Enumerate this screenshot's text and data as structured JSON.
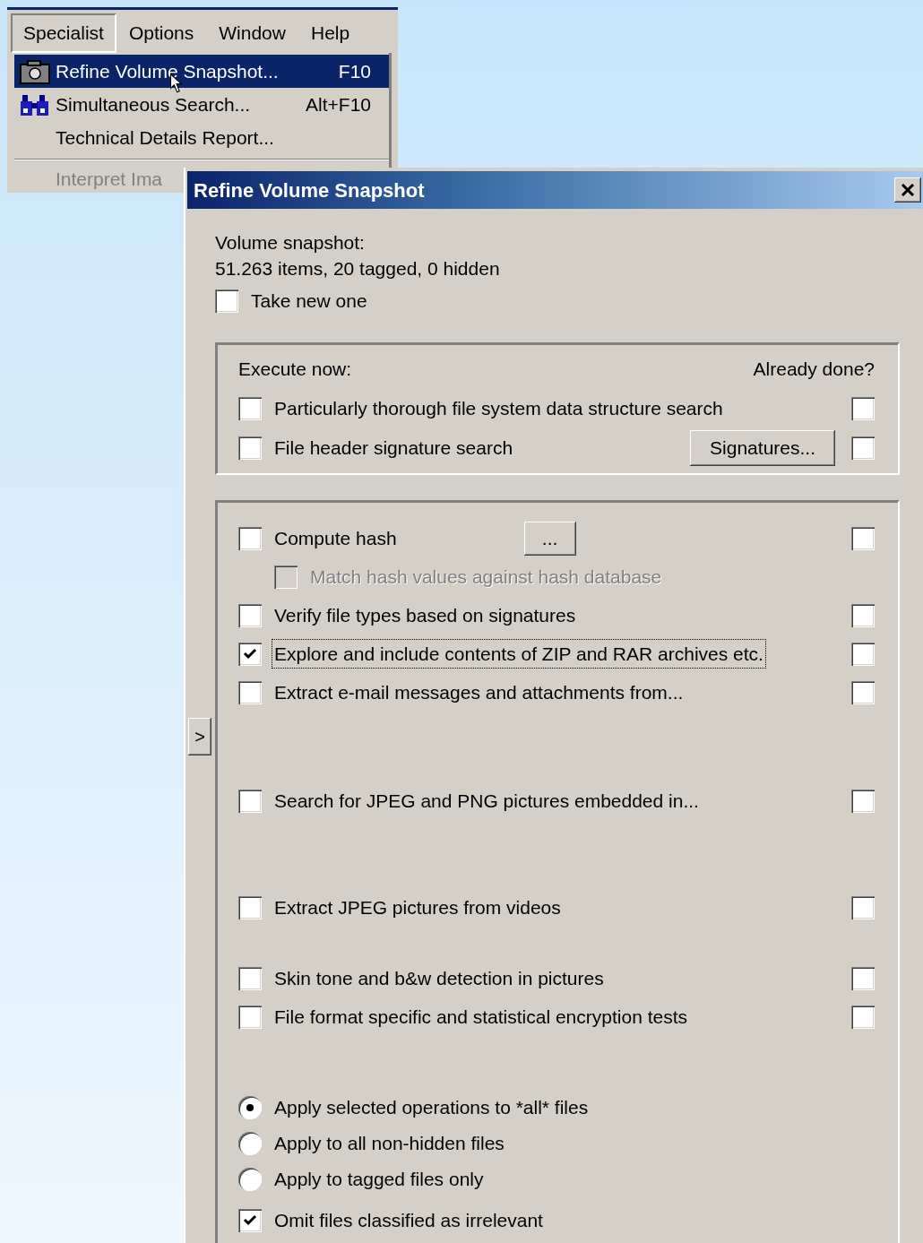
{
  "menu_bar": {
    "items": [
      {
        "label": "Specialist",
        "selected": true
      },
      {
        "label": "Options",
        "selected": false
      },
      {
        "label": "Window",
        "selected": false
      },
      {
        "label": "Help",
        "selected": false
      }
    ]
  },
  "menu": {
    "items": [
      {
        "kind": "command",
        "label": "Refine Volume Snapshot...",
        "shortcut": "F10",
        "highlighted": true,
        "disabled": false
      },
      {
        "kind": "command",
        "label": "Simultaneous Search...",
        "shortcut": "Alt+F10",
        "highlighted": false,
        "disabled": false
      },
      {
        "kind": "command",
        "label": "Technical Details Report...",
        "highlighted": false,
        "disabled": false
      },
      {
        "kind": "separator"
      },
      {
        "kind": "command",
        "label": "Interpret Ima",
        "highlighted": false,
        "disabled": true
      }
    ]
  },
  "dialog": {
    "title": "Refine Volume Snapshot",
    "snapshot_label": "Volume snapshot:",
    "snapshot_info": "51.263 items, 20 tagged, 0 hidden",
    "take_new": {
      "label": "Take new one",
      "checked": false
    },
    "execute": {
      "heading": "Execute now:",
      "done_heading": "Already done?",
      "options": [
        {
          "label": "Particularly thorough file system data structure search",
          "checked": false,
          "done_checked": false
        },
        {
          "label": "File header signature search",
          "checked": false,
          "done_checked": false,
          "button": "Signatures..."
        }
      ]
    },
    "expand_button": ">",
    "options": [
      {
        "kind": "check",
        "label": "Compute hash",
        "checked": false,
        "done_checked": false,
        "button": "..."
      },
      {
        "kind": "sub",
        "label": "Match hash values against hash database",
        "checked": false,
        "disabled": true
      },
      {
        "kind": "check",
        "label": "Verify file types based on signatures",
        "checked": false,
        "done_checked": false
      },
      {
        "kind": "check",
        "label": "Explore and include contents of ZIP and RAR archives etc.",
        "checked": true,
        "done_checked": false,
        "focused": true
      },
      {
        "kind": "check",
        "label": "Extract e-mail messages and attachments from...",
        "checked": false,
        "done_checked": false
      },
      {
        "kind": "check",
        "label": "Search for JPEG and PNG pictures embedded in...",
        "checked": false,
        "done_checked": false
      },
      {
        "kind": "check",
        "label": "Extract JPEG pictures from videos",
        "checked": false,
        "done_checked": false
      },
      {
        "kind": "check",
        "label": "Skin tone and b&w detection in pictures",
        "checked": false,
        "done_checked": false
      },
      {
        "kind": "check",
        "label": "File format specific and statistical encryption tests",
        "checked": false,
        "done_checked": false
      }
    ],
    "scope": [
      {
        "label": "Apply selected operations to *all* files",
        "selected": true
      },
      {
        "label": "Apply to all non-hidden files",
        "selected": false
      },
      {
        "label": "Apply to tagged files only",
        "selected": false
      }
    ],
    "omit": {
      "label": "Omit files classified as irrelevant",
      "checked": true
    }
  }
}
